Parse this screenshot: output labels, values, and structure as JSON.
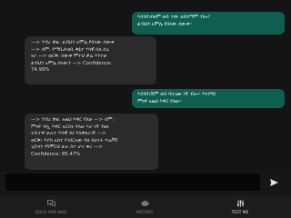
{
  "messages": [
    {
      "role": "user",
      "text": "እስንበገበዛም ወይ ተው አይሰማም ብሎ!\nልብህን አሞሌ የበላው ሰውቀ።"
    },
    {
      "role": "bot",
      "text": "—> ንብረ ቃል: ልብህን አሞሌ የበላው ሰውቀ\n—> ሰም: የማቢታወቢ ቅኔተ ሃሳዊ ሰለ ሲኒ\nነሆ —> ወርቅ: ሰውቀ ሞተህ ቃሬ እንተሁ\nልብህን አሞሌ በላውን —> Confidence:\n74.99%"
    },
    {
      "role": "user",
      "text": "እስንበገሽም ወይ ባላገሙ ነኝ ብሎ። እናንዓይ\nምነዋ አዜህ እዋር የለሁ።"
    },
    {
      "role": "bot",
      "text": "—> ንብረ ቃል: አዜህ እዋር የለሁ —> ሰም:\nምነዋ ብሏ እዋር አርስት የለሁ እራ ነኝ ብመ\nትቢተዋ ሁሉተ እሳዊ ነህ እስቃዘረገኝ —>\nወርቅ: እያስ አስተ የገበርአው ባለ በሆኑት ጥሬቫኝ\nጊዮክን ንግሞርህ ሁሉ ስተ ሆኖ ቀሪ —>\nConfidence: 85.47%"
    }
  ],
  "composer": {
    "placeholder": "",
    "value": ""
  },
  "nav": [
    {
      "label": "GOLD AND WAX",
      "icon": "chat-bubbles-icon",
      "active": false
    },
    {
      "label": "HISTORY",
      "icon": "robot-icon",
      "active": false
    },
    {
      "label": "TEST ME",
      "icon": "sliders-icon",
      "active": true
    }
  ],
  "colors": {
    "background": "#141414",
    "user_bubble": "#0f5f51",
    "bot_bubble": "#2b2b2b",
    "nav_bar": "#1c1c1c",
    "active_label": "#e6e6e6",
    "inactive_label": "#8a8a8a"
  }
}
